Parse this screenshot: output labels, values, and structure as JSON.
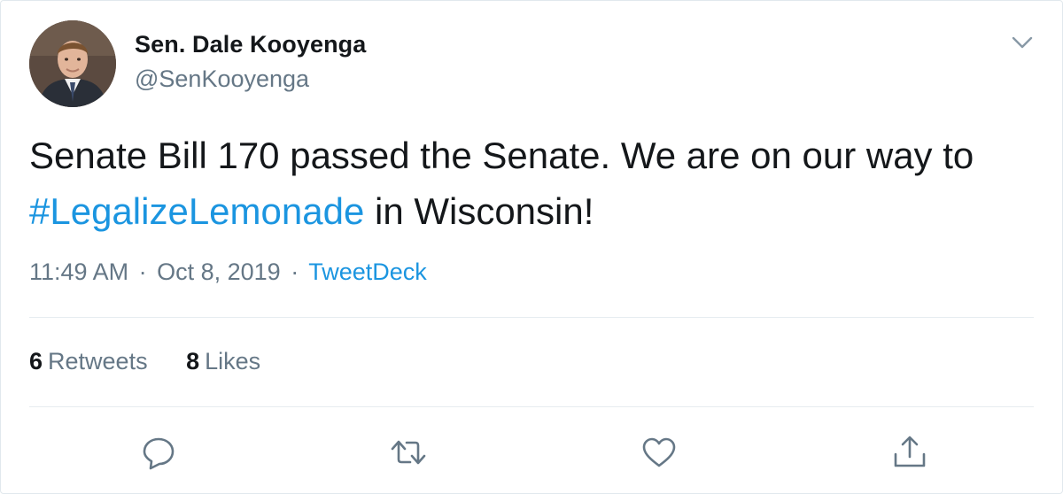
{
  "author": {
    "display_name": "Sen. Dale Kooyenga",
    "handle": "@SenKooyenga",
    "avatar_icon": "profile-photo"
  },
  "tweet": {
    "text_part1": "Senate Bill 170 passed the Senate. We are on our way to ",
    "hashtag": "#LegalizeLemonade",
    "text_part2": " in Wisconsin!"
  },
  "meta": {
    "time": "11:49 AM",
    "date": "Oct 8, 2019",
    "separator": "·",
    "source": "TweetDeck"
  },
  "stats": {
    "retweets_count": "6",
    "retweets_label": "Retweets",
    "likes_count": "8",
    "likes_label": "Likes"
  },
  "actions": [
    "reply-icon",
    "retweet-icon",
    "like-icon",
    "share-icon"
  ],
  "colors": {
    "link": "#1b95e0",
    "text": "#14171a",
    "secondary": "#657786",
    "border": "#e6ecf0"
  }
}
